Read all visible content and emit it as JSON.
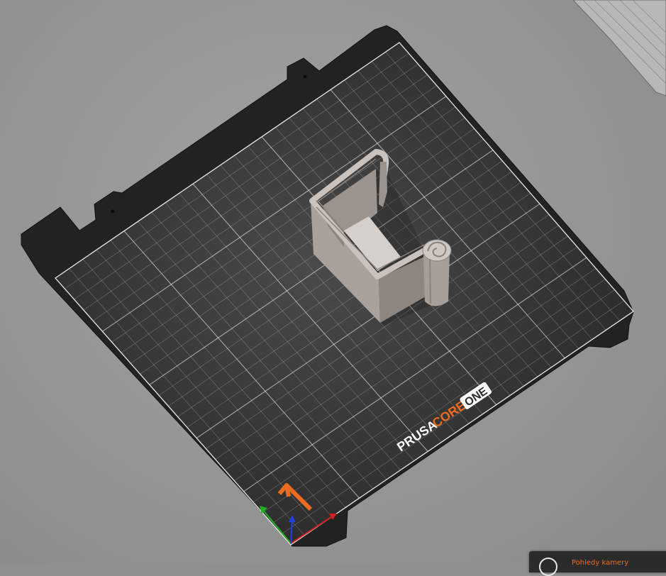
{
  "brand": {
    "prusa": "PRUSA",
    "core": "CORE",
    "one": "ONE"
  },
  "camera_tooltip": {
    "label": "Pohledy kamery",
    "icon": "camera-view-icon"
  },
  "colors": {
    "background": "#999999",
    "bed": "#2d2d2d",
    "bed_frame": "#202020",
    "grid": "#ffffff",
    "model": "#a69c95",
    "accent": "#ed6b21",
    "axis_x": "#d02020",
    "axis_y": "#20b020",
    "axis_z": "#2040e0"
  },
  "icons": [
    "prusa-logo-icon",
    "axis-gizmo-icon",
    "camera-view-icon"
  ]
}
